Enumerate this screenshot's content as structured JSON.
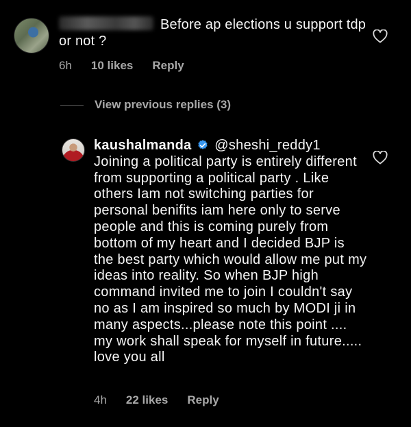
{
  "comments": [
    {
      "text": "Before ap elections u support tdp or not ?",
      "time": "6h",
      "likes": "10 likes",
      "reply_label": "Reply"
    },
    {
      "username": "kaushalmanda",
      "mention": "@sheshi_reddy1",
      "text": "Joining a political party is entirely different from supporting a political party . Like others Iam not switching parties for personal benifits iam here only  to serve people and this is coming  purely from bottom of my heart and I decided BJP is the best party which would allow me put my ideas into reality. So when  BJP high command invited me to join I couldn't say no as I am  inspired so much by MODI ji in many aspects...please note this point .... my work shall speak for myself in future..... love you all",
      "time": "4h",
      "likes": "22 likes",
      "reply_label": "Reply"
    }
  ],
  "view_previous_replies": "View previous replies (3)",
  "icons": {
    "like": "heart-outline-icon",
    "verified": "verified-badge-icon"
  },
  "colors": {
    "background": "#000000",
    "text": "#f5f5f5",
    "muted": "#a8a8a8",
    "verified": "#3897f0"
  }
}
